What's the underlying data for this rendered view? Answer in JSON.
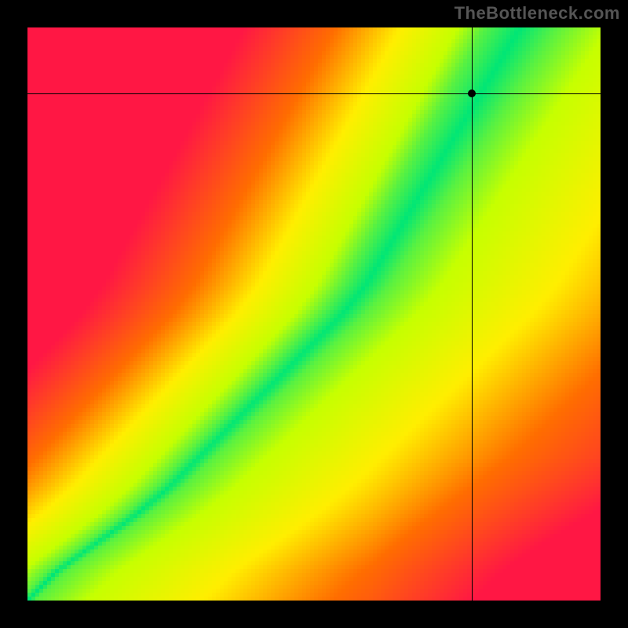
{
  "watermark": "TheBottleneck.com",
  "colors": {
    "background": "#000000",
    "watermark": "#555555",
    "crosshair": "#000000",
    "point": "#000000"
  },
  "chart_data": {
    "type": "heatmap",
    "title": "",
    "xlabel": "",
    "ylabel": "",
    "xlim": [
      0,
      1
    ],
    "ylim": [
      0,
      1
    ],
    "color_scale": {
      "low": "#ff1744",
      "mid_low": "#ff6d00",
      "mid": "#ffee00",
      "mid_high": "#c6ff00",
      "high": "#00e676"
    },
    "optimal_ridge": {
      "description": "Approximate center of green optimal band, parameterized by y in [0,1], giving x position",
      "points": [
        {
          "y": 0.0,
          "x": 0.0
        },
        {
          "y": 0.05,
          "x": 0.05
        },
        {
          "y": 0.1,
          "x": 0.12
        },
        {
          "y": 0.15,
          "x": 0.19
        },
        {
          "y": 0.2,
          "x": 0.25
        },
        {
          "y": 0.25,
          "x": 0.3
        },
        {
          "y": 0.3,
          "x": 0.35
        },
        {
          "y": 0.35,
          "x": 0.4
        },
        {
          "y": 0.4,
          "x": 0.45
        },
        {
          "y": 0.45,
          "x": 0.5
        },
        {
          "y": 0.5,
          "x": 0.55
        },
        {
          "y": 0.55,
          "x": 0.59
        },
        {
          "y": 0.6,
          "x": 0.62
        },
        {
          "y": 0.65,
          "x": 0.65
        },
        {
          "y": 0.7,
          "x": 0.68
        },
        {
          "y": 0.75,
          "x": 0.71
        },
        {
          "y": 0.8,
          "x": 0.74
        },
        {
          "y": 0.85,
          "x": 0.77
        },
        {
          "y": 0.9,
          "x": 0.8
        },
        {
          "y": 0.95,
          "x": 0.83
        },
        {
          "y": 1.0,
          "x": 0.86
        }
      ],
      "band_half_width": 0.055
    },
    "right_gradient": {
      "description": "Approximate fitness falloff slope to the right of ridge (per unit x)",
      "slope": 1.1
    },
    "left_gradient": {
      "description": "Approximate fitness falloff slope to the left of ridge (per unit x)",
      "slope": 2.2
    },
    "crosshair": {
      "x": 0.775,
      "y": 0.885
    },
    "annotations": []
  }
}
